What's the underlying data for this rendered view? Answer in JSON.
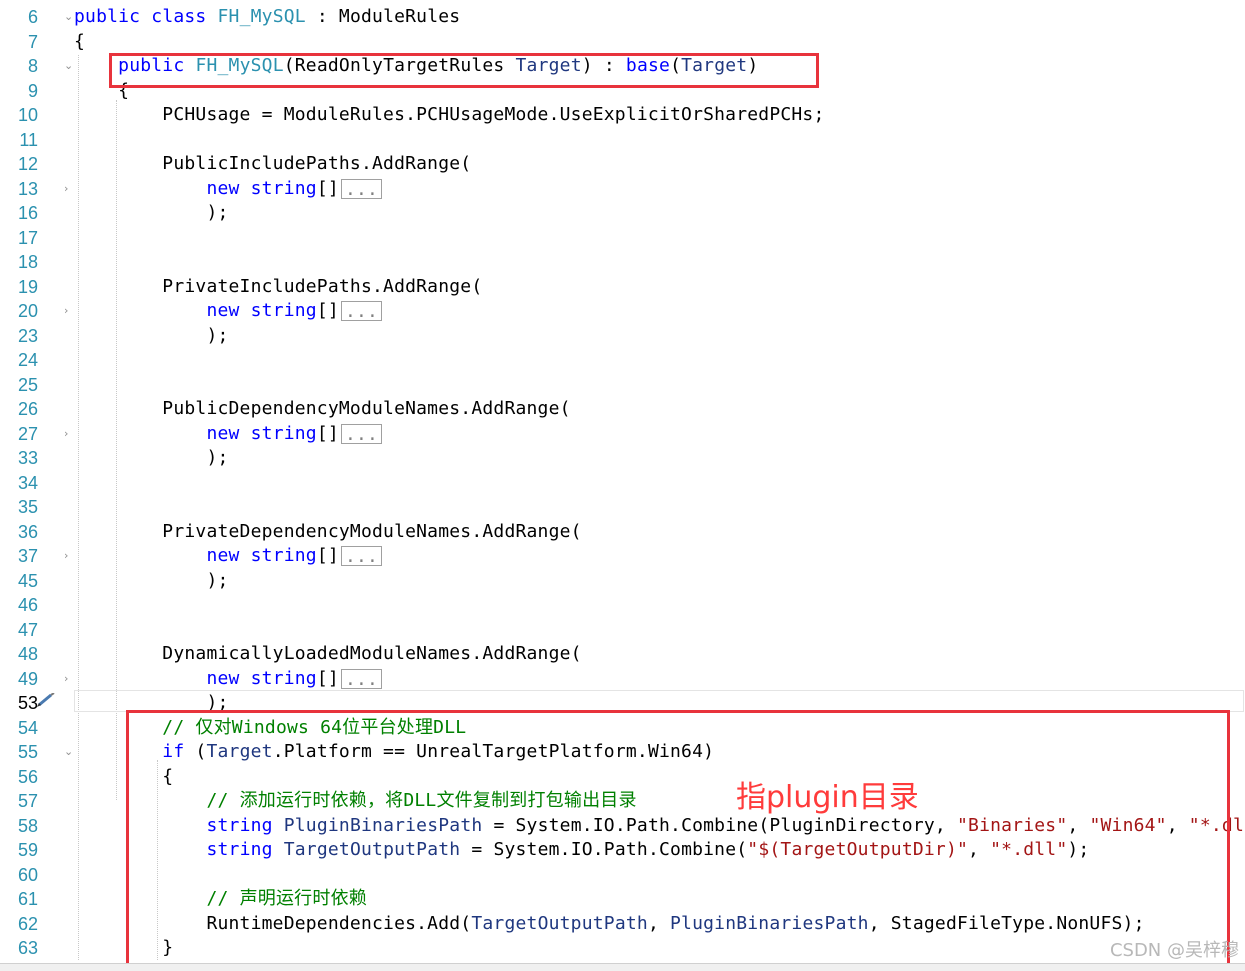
{
  "editor": {
    "lines": [
      {
        "num": "6",
        "tokens": [
          {
            "t": "public",
            "c": "kw"
          },
          {
            "t": " "
          },
          {
            "t": "class",
            "c": "kw"
          },
          {
            "t": " "
          },
          {
            "t": "FH_MySQL",
            "c": "type"
          },
          {
            "t": " : ModuleRules"
          }
        ]
      },
      {
        "num": "7",
        "tokens": [
          {
            "t": "{"
          }
        ]
      },
      {
        "num": "8",
        "tokens": [
          {
            "t": "    "
          },
          {
            "t": "public",
            "c": "kw"
          },
          {
            "t": " "
          },
          {
            "t": "FH_MySQL",
            "c": "type"
          },
          {
            "t": "(ReadOnlyTargetRules "
          },
          {
            "t": "Target",
            "c": "param"
          },
          {
            "t": ") : "
          },
          {
            "t": "base",
            "c": "kw"
          },
          {
            "t": "("
          },
          {
            "t": "Target",
            "c": "param"
          },
          {
            "t": ")"
          }
        ]
      },
      {
        "num": "9",
        "tokens": [
          {
            "t": "    {"
          }
        ]
      },
      {
        "num": "10",
        "tokens": [
          {
            "t": "        PCHUsage = ModuleRules.PCHUsageMode.UseExplicitOrSharedPCHs;"
          }
        ]
      },
      {
        "num": "11",
        "tokens": []
      },
      {
        "num": "12",
        "tokens": [
          {
            "t": "        PublicIncludePaths.AddRange("
          }
        ]
      },
      {
        "num": "13",
        "tokens": [
          {
            "t": "            "
          },
          {
            "t": "new",
            "c": "kw"
          },
          {
            "t": " "
          },
          {
            "t": "string",
            "c": "kw"
          },
          {
            "t": "[]"
          },
          {
            "t": "...",
            "c": "ellipsis"
          }
        ]
      },
      {
        "num": "16",
        "tokens": [
          {
            "t": "            );"
          }
        ]
      },
      {
        "num": "17",
        "tokens": []
      },
      {
        "num": "18",
        "tokens": []
      },
      {
        "num": "19",
        "tokens": [
          {
            "t": "        PrivateIncludePaths.AddRange("
          }
        ]
      },
      {
        "num": "20",
        "tokens": [
          {
            "t": "            "
          },
          {
            "t": "new",
            "c": "kw"
          },
          {
            "t": " "
          },
          {
            "t": "string",
            "c": "kw"
          },
          {
            "t": "[]"
          },
          {
            "t": "...",
            "c": "ellipsis"
          }
        ]
      },
      {
        "num": "23",
        "tokens": [
          {
            "t": "            );"
          }
        ]
      },
      {
        "num": "24",
        "tokens": []
      },
      {
        "num": "25",
        "tokens": []
      },
      {
        "num": "26",
        "tokens": [
          {
            "t": "        PublicDependencyModuleNames.AddRange("
          }
        ]
      },
      {
        "num": "27",
        "tokens": [
          {
            "t": "            "
          },
          {
            "t": "new",
            "c": "kw"
          },
          {
            "t": " "
          },
          {
            "t": "string",
            "c": "kw"
          },
          {
            "t": "[]"
          },
          {
            "t": "...",
            "c": "ellipsis"
          }
        ]
      },
      {
        "num": "33",
        "tokens": [
          {
            "t": "            );"
          }
        ]
      },
      {
        "num": "34",
        "tokens": []
      },
      {
        "num": "35",
        "tokens": []
      },
      {
        "num": "36",
        "tokens": [
          {
            "t": "        PrivateDependencyModuleNames.AddRange("
          }
        ]
      },
      {
        "num": "37",
        "tokens": [
          {
            "t": "            "
          },
          {
            "t": "new",
            "c": "kw"
          },
          {
            "t": " "
          },
          {
            "t": "string",
            "c": "kw"
          },
          {
            "t": "[]"
          },
          {
            "t": "...",
            "c": "ellipsis"
          }
        ]
      },
      {
        "num": "45",
        "tokens": [
          {
            "t": "            );"
          }
        ]
      },
      {
        "num": "46",
        "tokens": []
      },
      {
        "num": "47",
        "tokens": []
      },
      {
        "num": "48",
        "tokens": [
          {
            "t": "        DynamicallyLoadedModuleNames.AddRange("
          }
        ]
      },
      {
        "num": "49",
        "tokens": [
          {
            "t": "            "
          },
          {
            "t": "new",
            "c": "kw"
          },
          {
            "t": " "
          },
          {
            "t": "string",
            "c": "kw"
          },
          {
            "t": "[]"
          },
          {
            "t": "...",
            "c": "ellipsis"
          }
        ]
      },
      {
        "num": "53",
        "tokens": [
          {
            "t": "            );"
          }
        ]
      },
      {
        "num": "54",
        "tokens": [
          {
            "t": "        "
          },
          {
            "t": "// 仅对Windows 64位平台处理DLL",
            "c": "cmt"
          }
        ]
      },
      {
        "num": "55",
        "tokens": [
          {
            "t": "        "
          },
          {
            "t": "if",
            "c": "kw"
          },
          {
            "t": " ("
          },
          {
            "t": "Target",
            "c": "param"
          },
          {
            "t": ".Platform == UnrealTargetPlatform.Win64)"
          }
        ]
      },
      {
        "num": "56",
        "tokens": [
          {
            "t": "        {"
          }
        ]
      },
      {
        "num": "57",
        "tokens": [
          {
            "t": "            "
          },
          {
            "t": "// 添加运行时依赖，将DLL文件复制到打包输出目录",
            "c": "cmt"
          }
        ]
      },
      {
        "num": "58",
        "tokens": [
          {
            "t": "            "
          },
          {
            "t": "string",
            "c": "kw"
          },
          {
            "t": " "
          },
          {
            "t": "PluginBinariesPath",
            "c": "param"
          },
          {
            "t": " = System.IO.Path.Combine(PluginDirectory, "
          },
          {
            "t": "\"Binaries\"",
            "c": "str"
          },
          {
            "t": ", "
          },
          {
            "t": "\"Win64\"",
            "c": "str"
          },
          {
            "t": ", "
          },
          {
            "t": "\"*.dll\"",
            "c": "str"
          },
          {
            "t": ");"
          }
        ]
      },
      {
        "num": "59",
        "tokens": [
          {
            "t": "            "
          },
          {
            "t": "string",
            "c": "kw"
          },
          {
            "t": " "
          },
          {
            "t": "TargetOutputPath",
            "c": "param"
          },
          {
            "t": " = System.IO.Path.Combine("
          },
          {
            "t": "\"$(TargetOutputDir)\"",
            "c": "str"
          },
          {
            "t": ", "
          },
          {
            "t": "\"*.dll\"",
            "c": "str"
          },
          {
            "t": ");"
          }
        ]
      },
      {
        "num": "60",
        "tokens": []
      },
      {
        "num": "61",
        "tokens": [
          {
            "t": "            "
          },
          {
            "t": "// 声明运行时依赖",
            "c": "cmt"
          }
        ]
      },
      {
        "num": "62",
        "tokens": [
          {
            "t": "            RuntimeDependencies.Add("
          },
          {
            "t": "TargetOutputPath",
            "c": "param"
          },
          {
            "t": ", "
          },
          {
            "t": "PluginBinariesPath",
            "c": "param"
          },
          {
            "t": ", StagedFileType.NonUFS);"
          }
        ]
      },
      {
        "num": "63",
        "tokens": [
          {
            "t": "        }"
          }
        ]
      }
    ],
    "current_line": "53",
    "folded_lines": [
      "13",
      "20",
      "27",
      "37",
      "49"
    ],
    "fold_markers": [
      {
        "line": "6",
        "glyph": "⌄"
      },
      {
        "line": "8",
        "glyph": "⌄"
      },
      {
        "line": "13",
        "glyph": "›"
      },
      {
        "line": "20",
        "glyph": "›"
      },
      {
        "line": "27",
        "glyph": "›"
      },
      {
        "line": "37",
        "glyph": "›"
      },
      {
        "line": "49",
        "glyph": "›"
      },
      {
        "line": "55",
        "glyph": "⌄"
      }
    ]
  },
  "annotation_text": "指plugin目录",
  "watermark": "CSDN @吴梓穆",
  "colors": {
    "keyword": "#0000ff",
    "type": "#2b91af",
    "string": "#a31515",
    "comment": "#008000",
    "param": "#1f377f",
    "line_number": "#2b91af",
    "highlight_box": "#e8333c"
  },
  "icons": {
    "margin_glyph": "pencil-icon"
  }
}
